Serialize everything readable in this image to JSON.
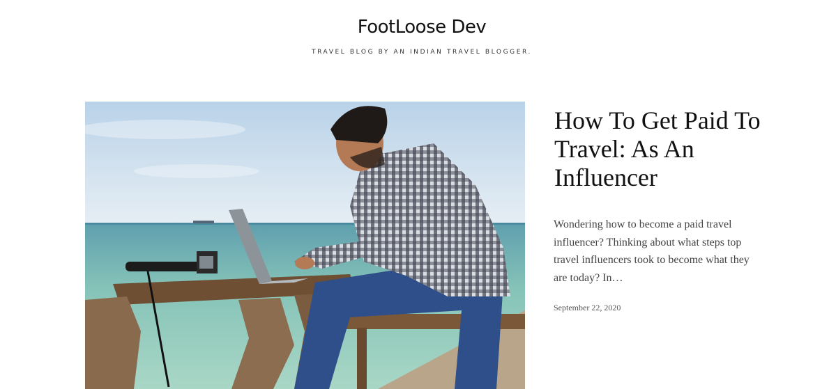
{
  "site": {
    "title": "FootLoose Dev",
    "tagline": "TRAVEL BLOG BY AN INDIAN TRAVEL BLOGGER."
  },
  "post": {
    "title": "How To Get Paid To Travel: As An Influencer",
    "excerpt": "Wondering how to become a paid travel influencer? Thinking about what steps top travel influencers took to become what they are today? In…",
    "date": "September 22, 2020",
    "image_icon": "featured-image-man-with-laptop-on-beach"
  },
  "colors": {
    "text": "#111111",
    "muted": "#444444",
    "sky": "#c9dcec",
    "sea": "#86c3b8"
  }
}
